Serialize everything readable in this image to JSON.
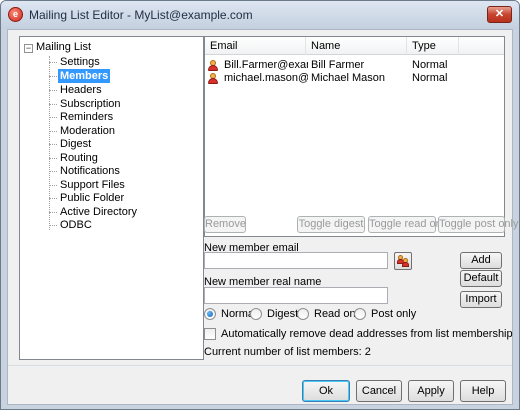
{
  "window": {
    "title": "Mailing List Editor - MyList@example.com",
    "close_glyph": "✕"
  },
  "tree": {
    "root_label": "Mailing List",
    "expander_glyph": "−",
    "items": [
      {
        "label": "Settings",
        "selected": false
      },
      {
        "label": "Members",
        "selected": true
      },
      {
        "label": "Headers",
        "selected": false
      },
      {
        "label": "Subscription",
        "selected": false
      },
      {
        "label": "Reminders",
        "selected": false
      },
      {
        "label": "Moderation",
        "selected": false
      },
      {
        "label": "Digest",
        "selected": false
      },
      {
        "label": "Routing",
        "selected": false
      },
      {
        "label": "Notifications",
        "selected": false
      },
      {
        "label": "Support Files",
        "selected": false
      },
      {
        "label": "Public Folder",
        "selected": false
      },
      {
        "label": "Active Directory",
        "selected": false
      },
      {
        "label": "ODBC",
        "selected": false
      }
    ]
  },
  "members": {
    "columns": [
      "Email",
      "Name",
      "Type"
    ],
    "rows": [
      {
        "email": "Bill.Farmer@example...",
        "name": "Bill Farmer",
        "type": "Normal",
        "icon": "user-icon"
      },
      {
        "email": "michael.mason@exa...",
        "name": "Michael Mason",
        "type": "Normal",
        "icon": "user-icon"
      }
    ]
  },
  "actions": {
    "remove": "Remove",
    "toggle_digest": "Toggle digest",
    "toggle_read_only": "Toggle read only",
    "toggle_post_only": "Toggle post only"
  },
  "form": {
    "email_label": "New member email",
    "email_value": "",
    "name_label": "New member real name",
    "name_value": "",
    "add": "Add",
    "default": "Default",
    "import": "Import"
  },
  "member_type": {
    "options": [
      "Normal",
      "Digest",
      "Read only",
      "Post only"
    ],
    "selected": "Normal"
  },
  "auto_remove": {
    "label": "Automatically remove dead addresses from list membership",
    "checked": false
  },
  "status": {
    "member_count_text": "Current number of list members: 2"
  },
  "footer": {
    "ok": "Ok",
    "cancel": "Cancel",
    "apply": "Apply",
    "help": "Help"
  }
}
